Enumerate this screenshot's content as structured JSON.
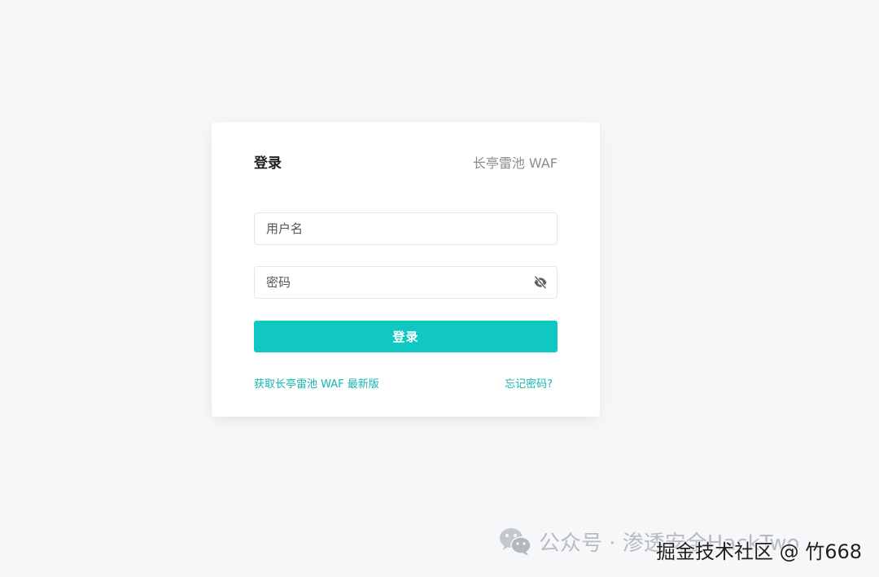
{
  "header": {
    "title": "登录",
    "product": "长亭雷池 WAF"
  },
  "form": {
    "username_placeholder": "用户名",
    "password_placeholder": "密码",
    "password_toggle_icon": "eye-off-icon",
    "submit_label": "登录"
  },
  "links": {
    "get_latest": "获取长亭雷池 WAF 最新版",
    "forgot_password": "忘记密码?"
  },
  "watermark": {
    "text": "公众号 · 渗透安全HackTwo",
    "icon": "wechat-icon"
  },
  "overlay": {
    "text": "掘金技术社区 @ 竹668"
  },
  "colors": {
    "accent": "#10c8c1",
    "link": "#16b5b0",
    "background": "#f6f7f9"
  }
}
